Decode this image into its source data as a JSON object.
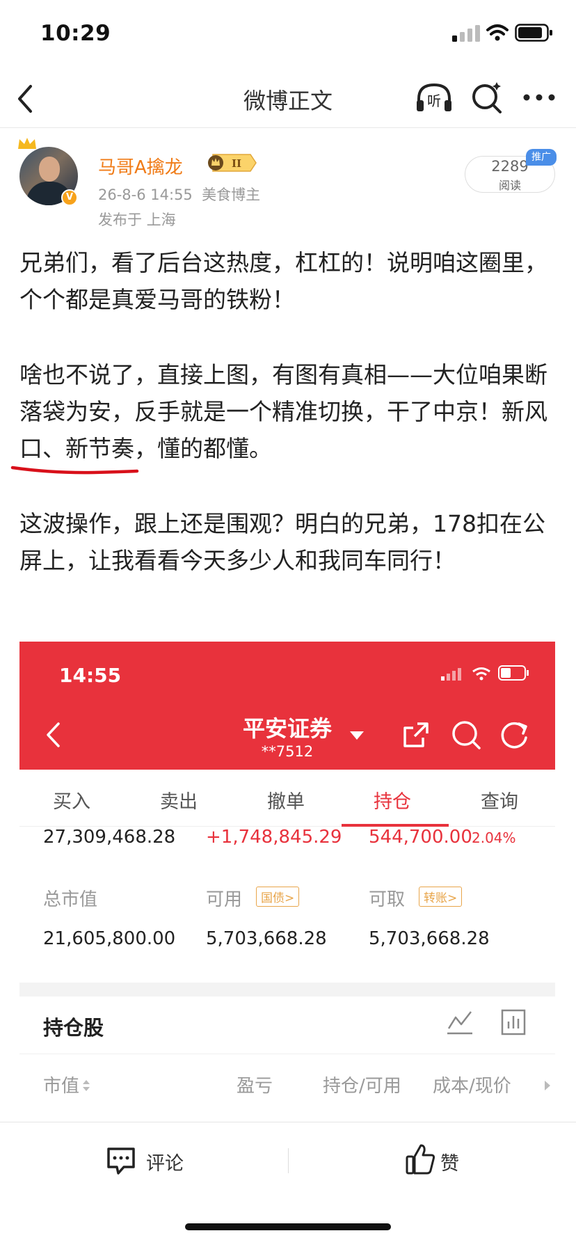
{
  "status_bar": {
    "time": "10:29"
  },
  "nav": {
    "title": "微博正文"
  },
  "post": {
    "username": "马哥A擒龙",
    "vip_level": "II",
    "meta": "26-8-6 14:55  美食博主",
    "location": "发布于 上海",
    "read_count": "2289",
    "read_label": "阅读",
    "promo_tag": "推广",
    "paragraphs": [
      "兄弟们，看了后台这热度，杠杠的！说明咱这圈里，个个都是真爱马哥的铁粉！",
      "啥也不说了，直接上图，有图有真相——大位咱果断落袋为安，反手就是一个精准切换，干了中京！新风口、新节奏，懂的都懂。",
      "这波操作，跟上还是围观？明白的兄弟，178扣在公屏上，让我看看今天多少人和我同车同行！"
    ]
  },
  "embed": {
    "time": "14:55",
    "title": "平安证券",
    "account": "**7512",
    "tabs": [
      "买入",
      "卖出",
      "撤单",
      "持仓",
      "查询"
    ],
    "active_tab_index": 3,
    "summary_row": [
      "27,309,468.28",
      "+1,748,845.29",
      "544,700.00",
      "2.04%"
    ],
    "labels": [
      "总市值",
      "可用",
      "可取"
    ],
    "tags": [
      "国债>",
      "转账>"
    ],
    "values": [
      "21,605,800.00",
      "5,703,668.28",
      "5,703,668.28"
    ],
    "holdings_title": "持仓股",
    "columns": [
      "市值",
      "盈亏",
      "持仓/可用",
      "成本/现价"
    ]
  },
  "bottom_bar": {
    "comment_label": "评论",
    "like_label": "赞"
  },
  "colors": {
    "accent_red": "#e8323c",
    "username_orange": "#f07b16",
    "promo_blue": "#4a8ee8"
  }
}
